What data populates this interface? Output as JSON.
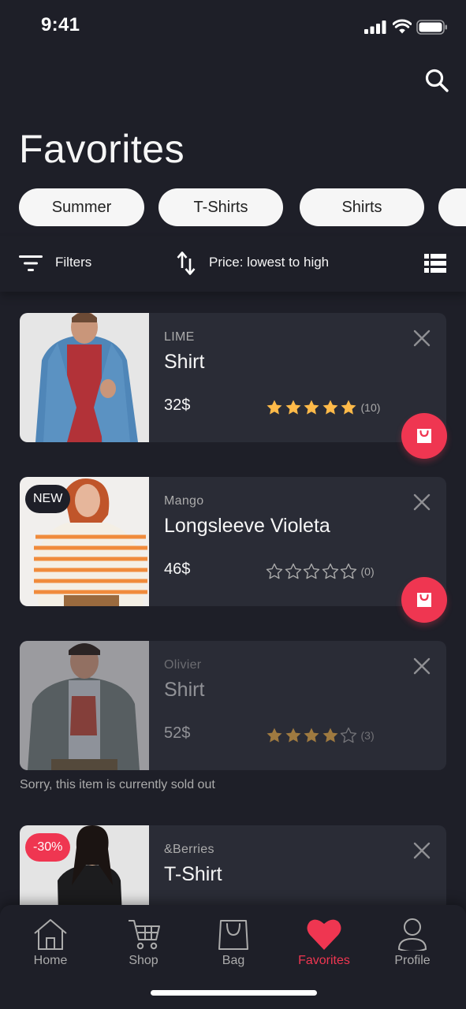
{
  "status_bar": {
    "time": "9:41"
  },
  "header": {
    "title": "Favorites",
    "search_icon": "search-icon"
  },
  "chips": [
    "Summer",
    "T-Shirts",
    "Shirts"
  ],
  "toolbar": {
    "filters_label": "Filters",
    "sort_label": "Price: lowest to high"
  },
  "products": [
    {
      "brand": "LIME",
      "name": "Shirt",
      "price": "32$",
      "rating": 5,
      "reviews": "(10)",
      "badge": "",
      "sold_out": false
    },
    {
      "brand": "Mango",
      "name": "Longsleeve Violeta",
      "price": "46$",
      "rating": 0,
      "reviews": "(0)",
      "badge": "NEW",
      "sold_out": false
    },
    {
      "brand": "Olivier",
      "name": "Shirt",
      "price": "52$",
      "rating": 4,
      "reviews": "(3)",
      "badge": "",
      "sold_out": true
    },
    {
      "brand": "&Berries",
      "name": "T-Shirt",
      "price": "",
      "rating": 0,
      "reviews": "",
      "badge": "-30%",
      "sold_out": false
    }
  ],
  "sold_out_note": "Sorry, this item is currently sold out",
  "bottom_nav": {
    "items": [
      {
        "label": "Home",
        "icon": "home-icon"
      },
      {
        "label": "Shop",
        "icon": "cart-icon"
      },
      {
        "label": "Bag",
        "icon": "bag-icon"
      },
      {
        "label": "Favorites",
        "icon": "heart-icon"
      },
      {
        "label": "Profile",
        "icon": "profile-icon"
      }
    ],
    "active": "Favorites"
  },
  "colors": {
    "background": "#1e1f28",
    "card": "#2a2c36",
    "accent": "#ef3651",
    "star": "#ffba49",
    "muted": "#ababab"
  }
}
